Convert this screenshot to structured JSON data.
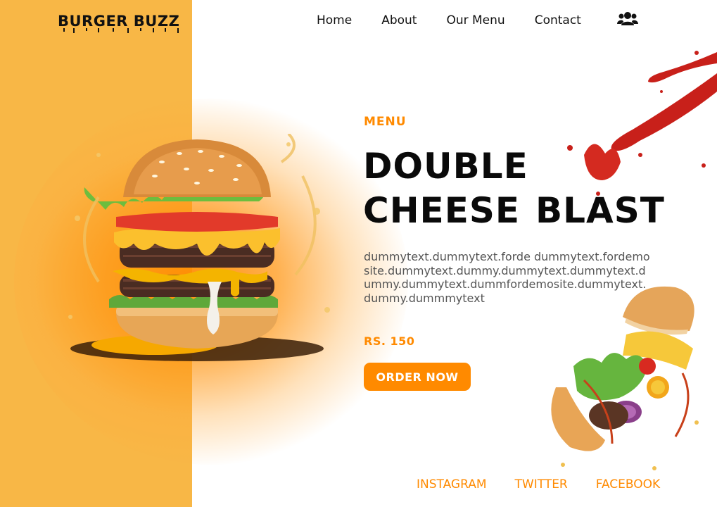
{
  "brand": {
    "logo": "BURGER BUZZ"
  },
  "nav": {
    "items": [
      {
        "label": "Home"
      },
      {
        "label": "About"
      },
      {
        "label": "Our Menu"
      },
      {
        "label": "Contact"
      }
    ],
    "account_icon": "users-icon"
  },
  "hero": {
    "tagline": "MENU",
    "title_line1": "DOUBLE",
    "title_line2a": "CHEESE",
    "title_line2b": "BLAST",
    "description": "dummytext.dummytext.forde dummytext.fordemosite.dummytext.dummy.dummytext.dummytext.dummy.dummytext.dummfordemosite.dummytext.dummy.dummmytext",
    "price": "RS. 150",
    "cta": "ORDER NOW"
  },
  "social": {
    "instagram": "INSTAGRAM",
    "twitter": "TWITTER",
    "facebook": "FACEBOOK"
  },
  "images": {
    "hero_burger": "double-burger-splash-image",
    "sauce": "ketchup-splash-image",
    "flying_burger": "exploding-burger-image"
  },
  "colors": {
    "accent": "#ff8a00",
    "panel": "#f8b746",
    "text": "#0a0a0a"
  }
}
